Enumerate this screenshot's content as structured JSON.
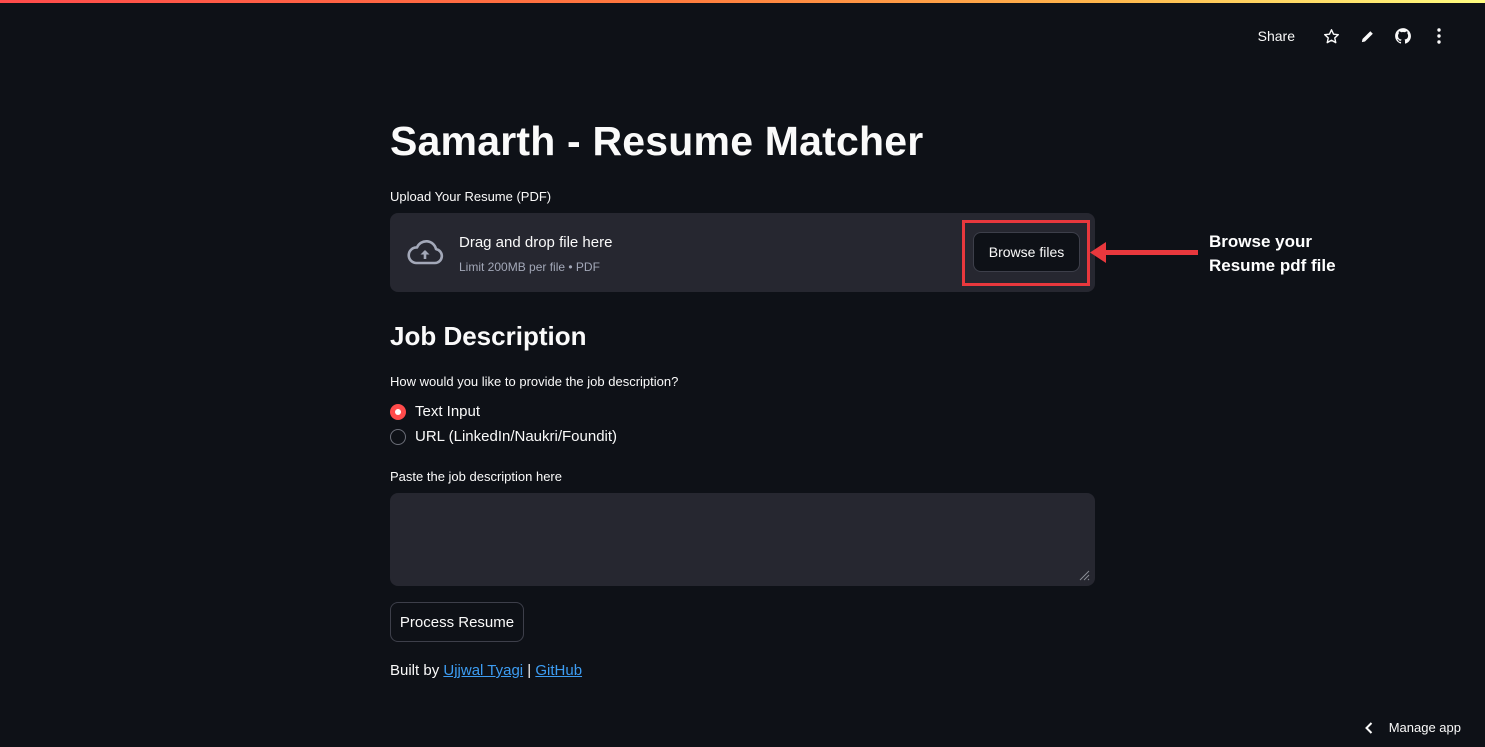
{
  "toolbar": {
    "share_label": "Share",
    "icons": [
      "star-icon",
      "pencil-icon",
      "github-icon",
      "more-vertical-icon"
    ]
  },
  "app": {
    "title": "Samarth - Resume Matcher"
  },
  "uploader": {
    "label": "Upload Your Resume (PDF)",
    "drag_text": "Drag and drop file here",
    "limit_text": "Limit 200MB per file • PDF",
    "browse_label": "Browse files",
    "icon": "cloud-upload-icon"
  },
  "annotation": {
    "text_line1": "Browse your",
    "text_line2": "Resume pdf file",
    "color": "#e8383d"
  },
  "job_description": {
    "heading": "Job Description",
    "radio_question": "How would you like to provide the job description?",
    "options": [
      {
        "label": "Text Input",
        "selected": true
      },
      {
        "label": "URL (LinkedIn/Naukri/Foundit)",
        "selected": false
      }
    ],
    "textarea_label": "Paste the job description here",
    "textarea_value": ""
  },
  "actions": {
    "process_label": "Process Resume"
  },
  "footer": {
    "prefix": "Built by ",
    "author_link": "Ujjwal Tyagi",
    "separator": " | ",
    "github_link": "GitHub"
  },
  "manage": {
    "label": "Manage app"
  },
  "colors": {
    "background": "#0e1117",
    "panel": "#262730",
    "accent": "#ff4b4b",
    "link": "#3d9df3"
  }
}
